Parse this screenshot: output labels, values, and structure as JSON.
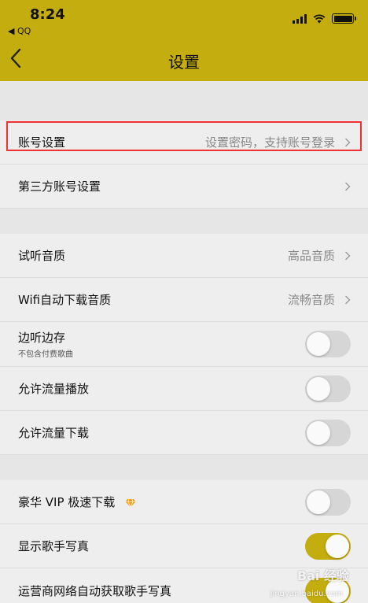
{
  "status": {
    "time": "8:24",
    "back_app": "◀ QQ"
  },
  "header": {
    "title": "设置"
  },
  "settings": {
    "account": {
      "label": "账号设置",
      "value": "设置密码，支持账号登录"
    },
    "third_party": {
      "label": "第三方账号设置"
    },
    "audition_quality": {
      "label": "试听音质",
      "value": "高品音质"
    },
    "wifi_download_quality": {
      "label": "Wifi自动下载音质",
      "value": "流畅音质"
    },
    "listen_and_save": {
      "label": "边听边存",
      "sublabel": "不包含付费歌曲",
      "enabled": false
    },
    "allow_data_play": {
      "label": "允许流量播放",
      "enabled": false
    },
    "allow_data_download": {
      "label": "允许流量下载",
      "enabled": false
    },
    "vip_fast_download": {
      "label": "豪华 VIP 极速下载",
      "enabled": false
    },
    "show_singer_photo": {
      "label": "显示歌手写真",
      "enabled": true
    },
    "carrier_auto_fetch_photo": {
      "label": "运营商网络自动获取歌手写真",
      "enabled": true
    }
  },
  "watermark": {
    "text": "Bai 经验",
    "sub": "jingyan.baidu.com"
  },
  "colors": {
    "accent": "#c4ad0e",
    "highlight": "#e33333",
    "toggle_off": "#d6d6d6"
  }
}
